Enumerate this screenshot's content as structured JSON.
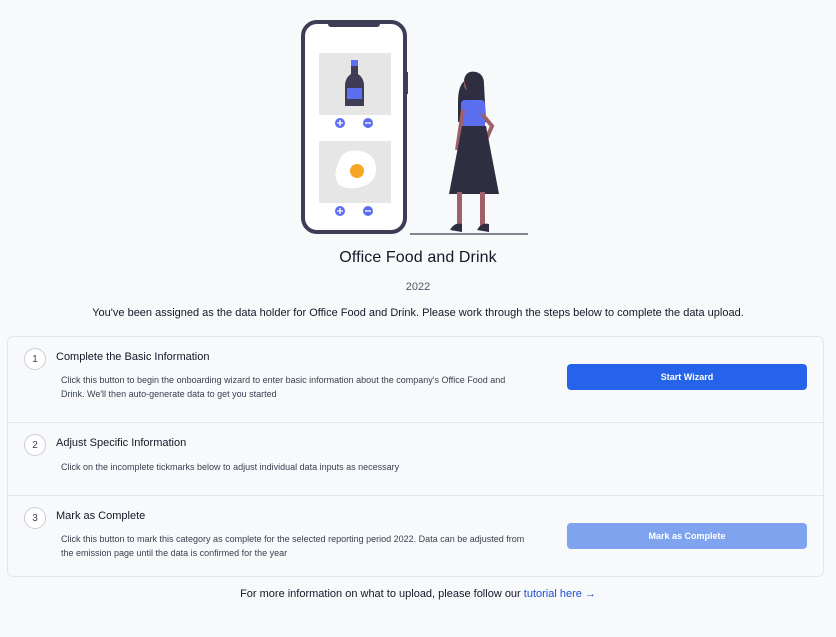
{
  "page": {
    "title": "Office Food and Drink",
    "year": "2022",
    "intro": "You've been assigned as the data holder for Office Food and Drink. Please work through the steps below to complete the data upload."
  },
  "steps": [
    {
      "number": "1",
      "title": "Complete the Basic Information",
      "description": "Click this button to begin the onboarding wizard to enter basic information about the company's Office Food and Drink. We'll then auto-generate data to get you started",
      "button_label": "Start Wizard"
    },
    {
      "number": "2",
      "title": "Adjust Specific Information",
      "description": "Click on the incomplete tickmarks below to adjust individual data inputs as necessary"
    },
    {
      "number": "3",
      "title": "Mark as Complete",
      "description": "Click this button to mark this category as complete for the selected reporting period 2022. Data can be adjusted from the emission page until the data is confirmed for the year",
      "button_label": "Mark as Complete"
    }
  ],
  "footer": {
    "text": "For more information on what to upload, please follow our",
    "link_label": "tutorial here →"
  },
  "colors": {
    "primary": "#2563eb",
    "primary_disabled": "#7fa3ee",
    "link": "#1d4ed8",
    "illustration_accent": "#5b6ef0"
  },
  "icons": [
    "phone-illustration",
    "bottle-icon",
    "fried-egg-icon",
    "plus-icon",
    "minus-icon",
    "woman-figure-illustration"
  ]
}
